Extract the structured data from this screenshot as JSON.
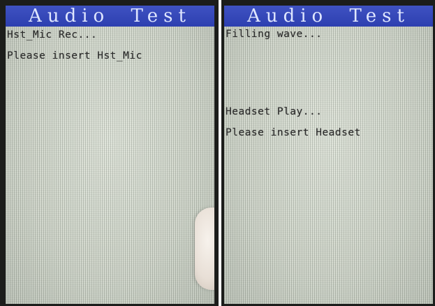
{
  "left_screen": {
    "title": "Audio Test",
    "lines": [
      "Hst_Mic Rec...",
      "Please insert Hst_Mic"
    ]
  },
  "right_screen": {
    "title": "Audio Test",
    "lines": [
      "Filling wave...",
      "Headset Play...",
      "Please insert Headset"
    ]
  },
  "colors": {
    "title_bar": "#2d3fb0",
    "title_text": "#dfe6ff",
    "screen_background": "#cdd3c7",
    "body_text": "#2b2b2b",
    "bezel": "#1c1d1b"
  }
}
